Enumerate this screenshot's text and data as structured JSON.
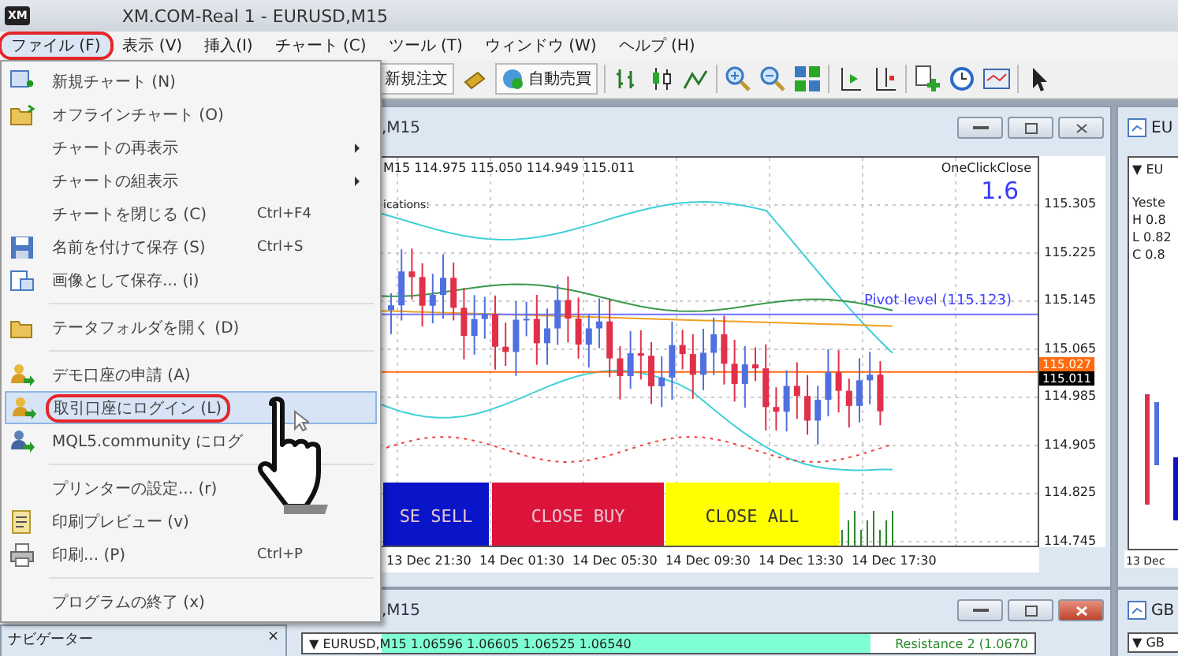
{
  "window": {
    "logo": "XM",
    "title": "XM.COM-Real 1 - EURUSD,M15"
  },
  "menu_bar": [
    {
      "label": "ファイル (F)",
      "selected": true,
      "annotated": true
    },
    {
      "label": "表示 (V)",
      "selected": false,
      "annotated": false
    },
    {
      "label": "挿入(I)",
      "selected": false,
      "annotated": false
    },
    {
      "label": "チャート (C)",
      "selected": false,
      "annotated": false
    },
    {
      "label": "ツール (T)",
      "selected": false,
      "annotated": false
    },
    {
      "label": "ウィンドウ (W)",
      "selected": false,
      "annotated": false
    },
    {
      "label": "ヘルプ (H)",
      "selected": false,
      "annotated": false
    }
  ],
  "toolbar": {
    "buttons": [
      {
        "kind": "text",
        "label": "新規注文"
      },
      {
        "kind": "robot",
        "label": "自動売買"
      }
    ]
  },
  "file_menu": [
    {
      "kind": "item",
      "label": "新規チャート (N)",
      "selected": false,
      "annotated": false
    },
    {
      "kind": "item",
      "label": "オフラインチャート (O)",
      "selected": false,
      "annotated": false
    },
    {
      "kind": "submenu",
      "label": "チャートの再表示",
      "selected": false,
      "annotated": false
    },
    {
      "kind": "submenu",
      "label": "チャートの組表示",
      "selected": false,
      "annotated": false
    },
    {
      "kind": "item",
      "label": "チャートを閉じる (C)",
      "shortcut": "Ctrl+F4",
      "selected": false,
      "annotated": false
    },
    {
      "kind": "item",
      "label": "名前を付けて保存 (S)",
      "shortcut": "Ctrl+S",
      "selected": false,
      "annotated": false
    },
    {
      "kind": "item",
      "label": "画像として保存... (i)",
      "selected": false,
      "annotated": false
    },
    {
      "kind": "separator"
    },
    {
      "kind": "item",
      "label": "テータフォルダを開く (D)",
      "selected": false,
      "annotated": false
    },
    {
      "kind": "separator"
    },
    {
      "kind": "item",
      "label": "デモ口座の申請 (A)",
      "selected": false,
      "annotated": false
    },
    {
      "kind": "item",
      "label": "取引口座にログイン (L)",
      "selected": true,
      "annotated": true
    },
    {
      "kind": "item",
      "label": "MQL5.community にログ",
      "selected": false,
      "annotated": false
    },
    {
      "kind": "separator"
    },
    {
      "kind": "item",
      "label": "プリンターの設定... (r)",
      "selected": false,
      "annotated": false
    },
    {
      "kind": "item",
      "label": "印刷プレビュー (v)",
      "selected": false,
      "annotated": false
    },
    {
      "kind": "item",
      "label": "印刷... (P)",
      "shortcut": "Ctrl+P",
      "selected": false,
      "annotated": false
    },
    {
      "kind": "separator"
    },
    {
      "kind": "item",
      "label": "プログラムの終了 (x)",
      "selected": false,
      "annotated": false
    }
  ],
  "chart_window": {
    "title": ",M15",
    "header": "M15 114.975 115.050 114.949 115.011",
    "indicator_text": "ications:",
    "oneclick_label": "OneClickClose",
    "oneclick_value": "1.6",
    "pivot_label": "Pivot level (115.123)",
    "price_axis": [
      {
        "kind": "grid",
        "label": "115.305"
      },
      {
        "kind": "grid",
        "label": "115.225"
      },
      {
        "kind": "grid",
        "label": "115.145"
      },
      {
        "kind": "grid",
        "label": "115.065"
      },
      {
        "kind": "ask",
        "label": "115.027"
      },
      {
        "kind": "bid",
        "label": "115.011"
      },
      {
        "kind": "grid",
        "label": "114.985"
      },
      {
        "kind": "grid",
        "label": "114.905"
      },
      {
        "kind": "grid",
        "label": "114.825"
      },
      {
        "kind": "grid",
        "label": "114.745"
      }
    ],
    "buttons": [
      {
        "label": "SE SELL",
        "color": "#0a14c8"
      },
      {
        "label": "CLOSE BUY",
        "color": "#dc143c"
      },
      {
        "label": "CLOSE ALL",
        "color": "#ffff00"
      }
    ],
    "time_axis": [
      "13 Dec 21:30",
      "14 Dec 01:30",
      "14 Dec 05:30",
      "14 Dec 09:30",
      "14 Dec 13:30",
      "14 Dec 17:30"
    ]
  },
  "right_window": {
    "title": "EU",
    "symbol": "▼ EU",
    "info": [
      "Yeste",
      "H 0.8",
      "L 0.82",
      "C 0.8"
    ],
    "time": "13 Dec"
  },
  "bottom_window": {
    "title": ",M15",
    "symbol_row": "▼ EURUSD,M15 1.06596 1.06605 1.06525 1.06540",
    "resistance_label": "Resistance 2 (1.0670"
  },
  "bottom_right_window": {
    "title": "GB",
    "symbol": "▼ GB"
  },
  "navigator": {
    "title": "ナビゲーター",
    "close": "×"
  }
}
